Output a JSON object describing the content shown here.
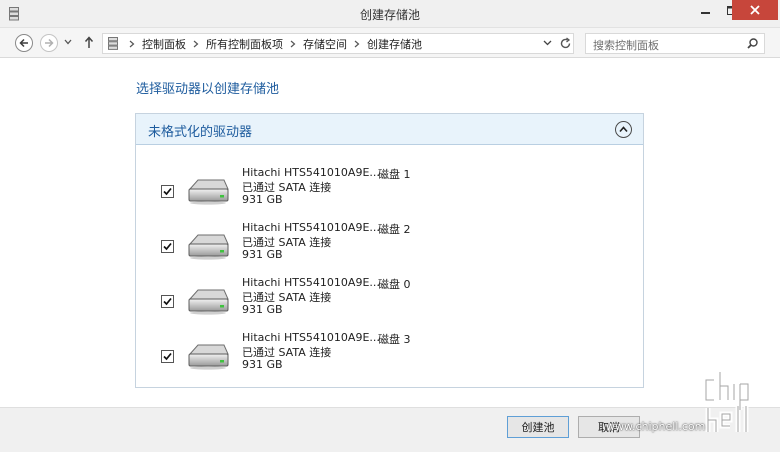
{
  "window": {
    "title": "创建存储池"
  },
  "address": {
    "crumbs": [
      "控制面板",
      "所有控制面板项",
      "存储空间",
      "创建存储池"
    ]
  },
  "search": {
    "placeholder": "搜索控制面板"
  },
  "heading": "选择驱动器以创建存储池",
  "group": {
    "title": "未格式化的驱动器",
    "drives": [
      {
        "name": "Hitachi HTS541010A9E...",
        "disk": "磁盘 1",
        "connection": "已通过 SATA 连接",
        "size": "931 GB",
        "checked": true
      },
      {
        "name": "Hitachi HTS541010A9E...",
        "disk": "磁盘 2",
        "connection": "已通过 SATA 连接",
        "size": "931 GB",
        "checked": true
      },
      {
        "name": "Hitachi HTS541010A9E...",
        "disk": "磁盘 0",
        "connection": "已通过 SATA 连接",
        "size": "931 GB",
        "checked": true
      },
      {
        "name": "Hitachi HTS541010A9E...",
        "disk": "磁盘 3",
        "connection": "已通过 SATA 连接",
        "size": "931 GB",
        "checked": true
      }
    ]
  },
  "buttons": {
    "create": "创建池",
    "cancel": "取消"
  },
  "watermark": {
    "url": "www.chiphell.com"
  },
  "icons": {
    "app": "storage-icon",
    "back": "back-arrow-icon",
    "forward": "forward-arrow-icon",
    "up": "up-arrow-icon",
    "refresh": "refresh-icon",
    "search": "search-icon",
    "collapse": "chevron-up-icon",
    "drive": "hard-drive-icon"
  },
  "colors": {
    "accent": "#1e5c9e",
    "group_header": "#e8f3fb",
    "close_button": "#c7463b"
  }
}
